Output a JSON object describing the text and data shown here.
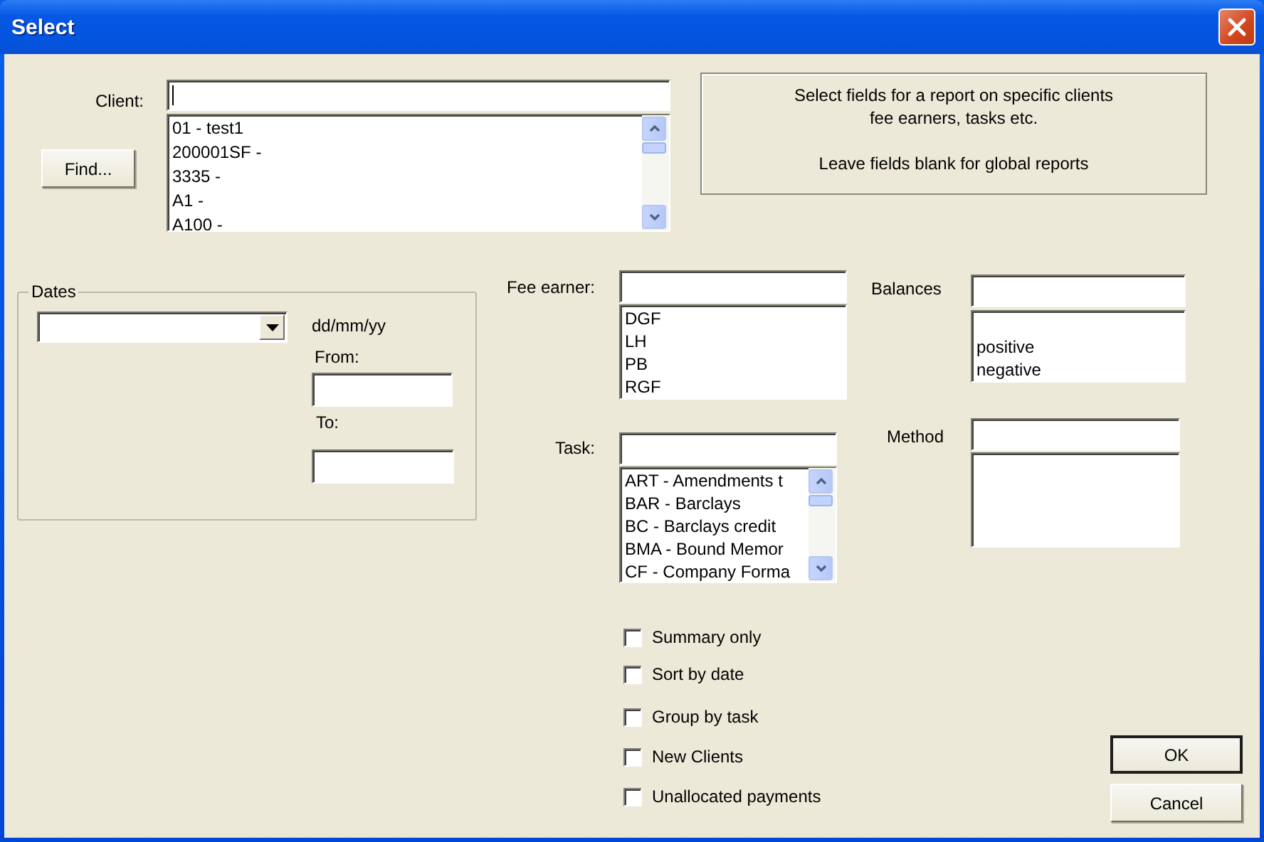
{
  "window": {
    "title": "Select"
  },
  "client": {
    "label": "Client:",
    "items": [
      "01 - test1",
      "200001SF -",
      "3335 -",
      "A1 -",
      "A100 -"
    ]
  },
  "find_button": "Find...",
  "info": [
    "Select fields for a report on specific clients",
    "fee earners, tasks etc.",
    "Leave fields blank for global reports"
  ],
  "dates": {
    "legend": "Dates",
    "format": "dd/mm/yy",
    "from_label": "From:",
    "to_label": "To:"
  },
  "fee_earner": {
    "label": "Fee earner:",
    "items": [
      "DGF",
      "LH",
      "PB",
      "RGF"
    ]
  },
  "balances": {
    "label": "Balances",
    "items": [
      "positive",
      "negative"
    ]
  },
  "task": {
    "label": "Task:",
    "items": [
      "ART - Amendments t",
      "BAR - Barclays",
      "BC - Barclays credit",
      "BMA - Bound Memor",
      "CF - Company Forma"
    ]
  },
  "method": {
    "label": "Method"
  },
  "options": [
    {
      "label": "Summary only",
      "checked": false
    },
    {
      "label": "Sort by date",
      "checked": false
    },
    {
      "label": "Group by task",
      "checked": false
    },
    {
      "label": "New Clients",
      "checked": false
    },
    {
      "label": "Unallocated payments",
      "checked": false
    }
  ],
  "buttons": [
    {
      "label": "OK",
      "default": true
    },
    {
      "label": "Cancel",
      "default": false
    }
  ]
}
